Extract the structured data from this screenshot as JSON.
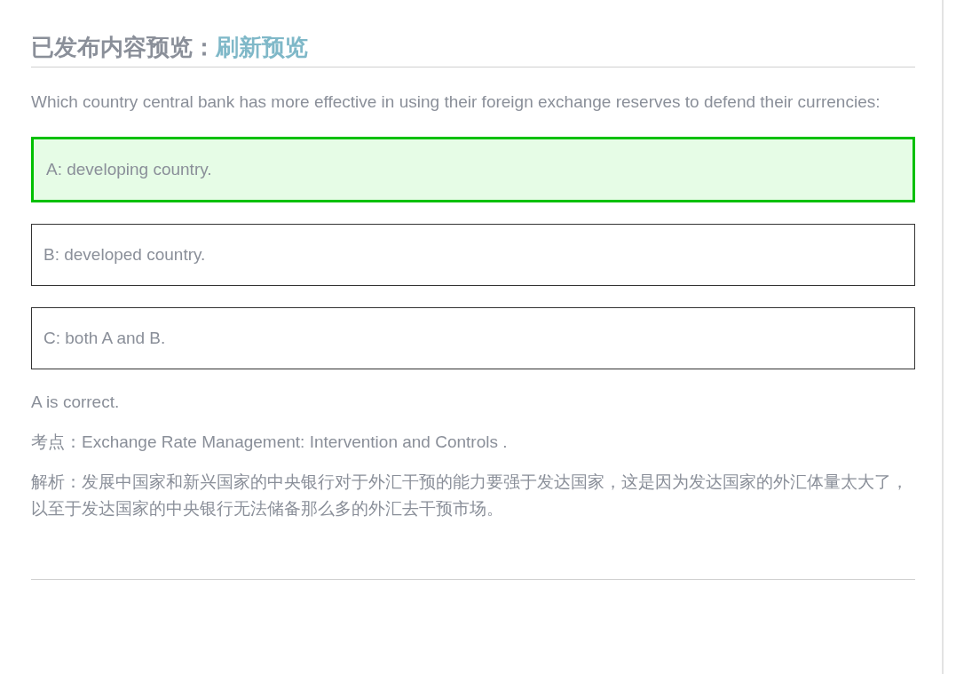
{
  "header": {
    "title": "已发布内容预览：",
    "link": "刷新预览"
  },
  "question": "Which country central bank has more effective in using their foreign exchange reserves to defend their currencies:",
  "options": [
    {
      "text": "A: developing country.",
      "correct": true
    },
    {
      "text": "B: developed country.",
      "correct": false
    },
    {
      "text": "C: both A and B.",
      "correct": false
    }
  ],
  "result": "A is correct.",
  "topic": "考点：Exchange Rate Management: Intervention and Controls .",
  "analysis": "解析：发展中国家和新兴国家的中央银行对于外汇干预的能力要强于发达国家，这是因为发达国家的外汇体量太大了，以至于发达国家的中央银行无法储备那么多的外汇去干预市场。"
}
